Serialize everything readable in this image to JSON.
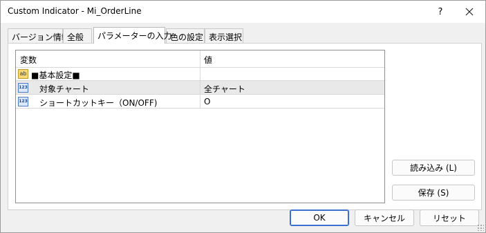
{
  "window": {
    "title": "Custom Indicator - Mi_OrderLine",
    "help_label": "?"
  },
  "tabs": [
    {
      "label": "バージョン情報"
    },
    {
      "label": "全般"
    },
    {
      "label": "パラメーターの入力",
      "active": true
    },
    {
      "label": "色の設定"
    },
    {
      "label": "表示選択"
    }
  ],
  "grid": {
    "columns": {
      "variable": "変数",
      "value": "値"
    },
    "group": {
      "label": "■基本設定■",
      "icon": "abc-icon"
    },
    "rows": [
      {
        "name": "対象チャート",
        "value": "全チャート",
        "icon": "numeric-123-icon",
        "selected": true
      },
      {
        "name": "ショートカットキー（ON/OFF)",
        "value": "O",
        "icon": "numeric-123-icon",
        "selected": false
      }
    ]
  },
  "side_buttons": {
    "load": "読み込み (L)",
    "save": "保存 (S)"
  },
  "footer": {
    "ok": "OK",
    "cancel": "キャンセル",
    "reset": "リセット"
  },
  "colors": {
    "accent": "#3a6fd1",
    "selected_row": "#e9e9e9"
  }
}
